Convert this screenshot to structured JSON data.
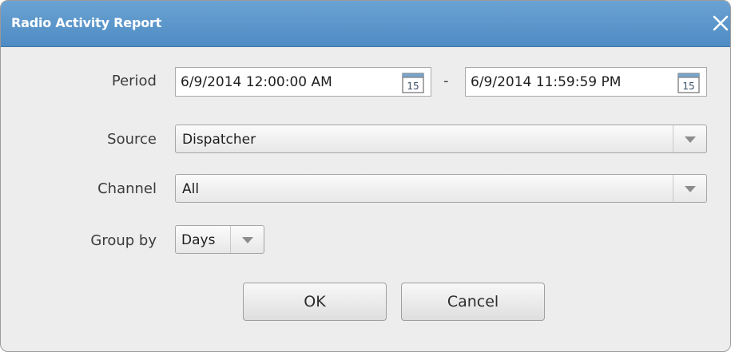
{
  "window": {
    "title": "Radio Activity Report",
    "close_icon": "close-icon"
  },
  "period": {
    "label": "Period",
    "start_value": "6/9/2014 12:00:00 AM",
    "separator": "-",
    "end_value": "6/9/2014 11:59:59 PM",
    "calendar_icon_text": "15"
  },
  "source": {
    "label": "Source",
    "selected": "Dispatcher"
  },
  "channel": {
    "label": "Channel",
    "selected": "All"
  },
  "group_by": {
    "label": "Group by",
    "selected": "Days"
  },
  "buttons": {
    "ok_label": "OK",
    "cancel_label": "Cancel"
  },
  "colors": {
    "titlebar": "#5b96cb",
    "dialog_bg": "#ededed",
    "calendar_header": "#7aa4c8"
  }
}
